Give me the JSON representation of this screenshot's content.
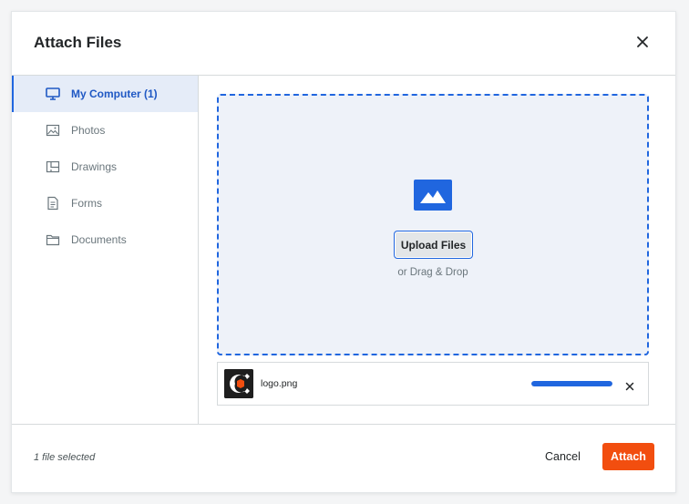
{
  "dialog": {
    "title": "Attach Files",
    "close_icon": "close-icon"
  },
  "sidebar": {
    "items": [
      {
        "label": "My Computer (1)",
        "icon": "monitor-icon",
        "active": true
      },
      {
        "label": "Photos",
        "icon": "image-icon",
        "active": false
      },
      {
        "label": "Drawings",
        "icon": "drawing-icon",
        "active": false
      },
      {
        "label": "Forms",
        "icon": "form-icon",
        "active": false
      },
      {
        "label": "Documents",
        "icon": "folder-icon",
        "active": false
      }
    ]
  },
  "dropzone": {
    "icon": "image-icon",
    "upload_label": "Upload Files",
    "drag_text": "or Drag & Drop"
  },
  "files": [
    {
      "name": "logo.png",
      "progress": 1.0,
      "remove_icon": "close-icon"
    }
  ],
  "footer": {
    "status": "1 file selected",
    "cancel_label": "Cancel",
    "attach_label": "Attach"
  },
  "colors": {
    "accent": "#2066df",
    "primary_action": "#f24e0f",
    "active_bg": "#e5ecf8",
    "dropzone_bg": "#eef2f9"
  }
}
